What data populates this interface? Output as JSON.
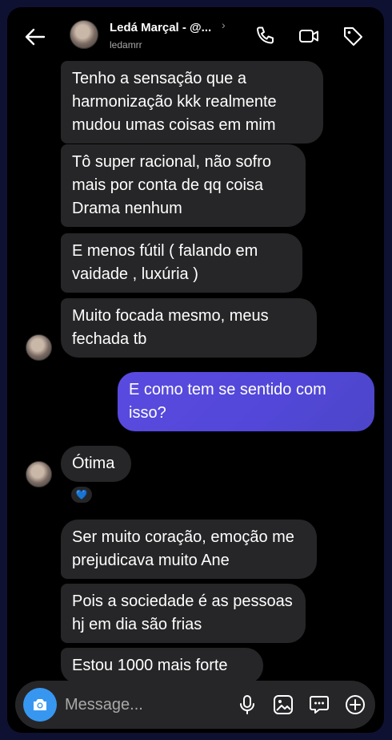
{
  "header": {
    "name": "Ledá Marçal - @...",
    "chevron": "›",
    "username": "ledamrr",
    "icons": [
      "back-arrow-icon",
      "phone-icon",
      "video-icon",
      "tag-icon"
    ]
  },
  "messages": [
    {
      "id": 1,
      "from": "them",
      "text": "Tenho a sensação que a harmonização kkk realmente mudou umas coisas em mim"
    },
    {
      "id": 2,
      "from": "them",
      "text": "Tô super racional, não sofro mais por conta de qq coisa Drama nenhum"
    },
    {
      "id": 3,
      "from": "them",
      "text": "E menos fútil ( falando em vaidade , luxúria )"
    },
    {
      "id": 4,
      "from": "them",
      "text": "Muito focada mesmo, meus fechada tb"
    },
    {
      "id": 5,
      "from": "me",
      "text": "E como tem se sentido com isso?"
    },
    {
      "id": 6,
      "from": "them",
      "text": "Ótima",
      "reaction": "💙"
    },
    {
      "id": 7,
      "from": "them",
      "text": "Ser muito coração, emoção me prejudicava muito Ane"
    },
    {
      "id": 8,
      "from": "them",
      "text": "Pois a sociedade é as pessoas hj em dia são frias"
    },
    {
      "id": 9,
      "from": "them",
      "text": "Estou 1000 mais forte"
    }
  ],
  "composer": {
    "placeholder": "Message...",
    "icons": [
      "camera-icon",
      "microphone-icon",
      "gallery-icon",
      "sticker-icon",
      "plus-icon"
    ]
  },
  "colors": {
    "outgoing_bubble": "#5247d8",
    "incoming_bubble": "#262628",
    "camera_button": "#3797f0",
    "background": "#000000"
  }
}
